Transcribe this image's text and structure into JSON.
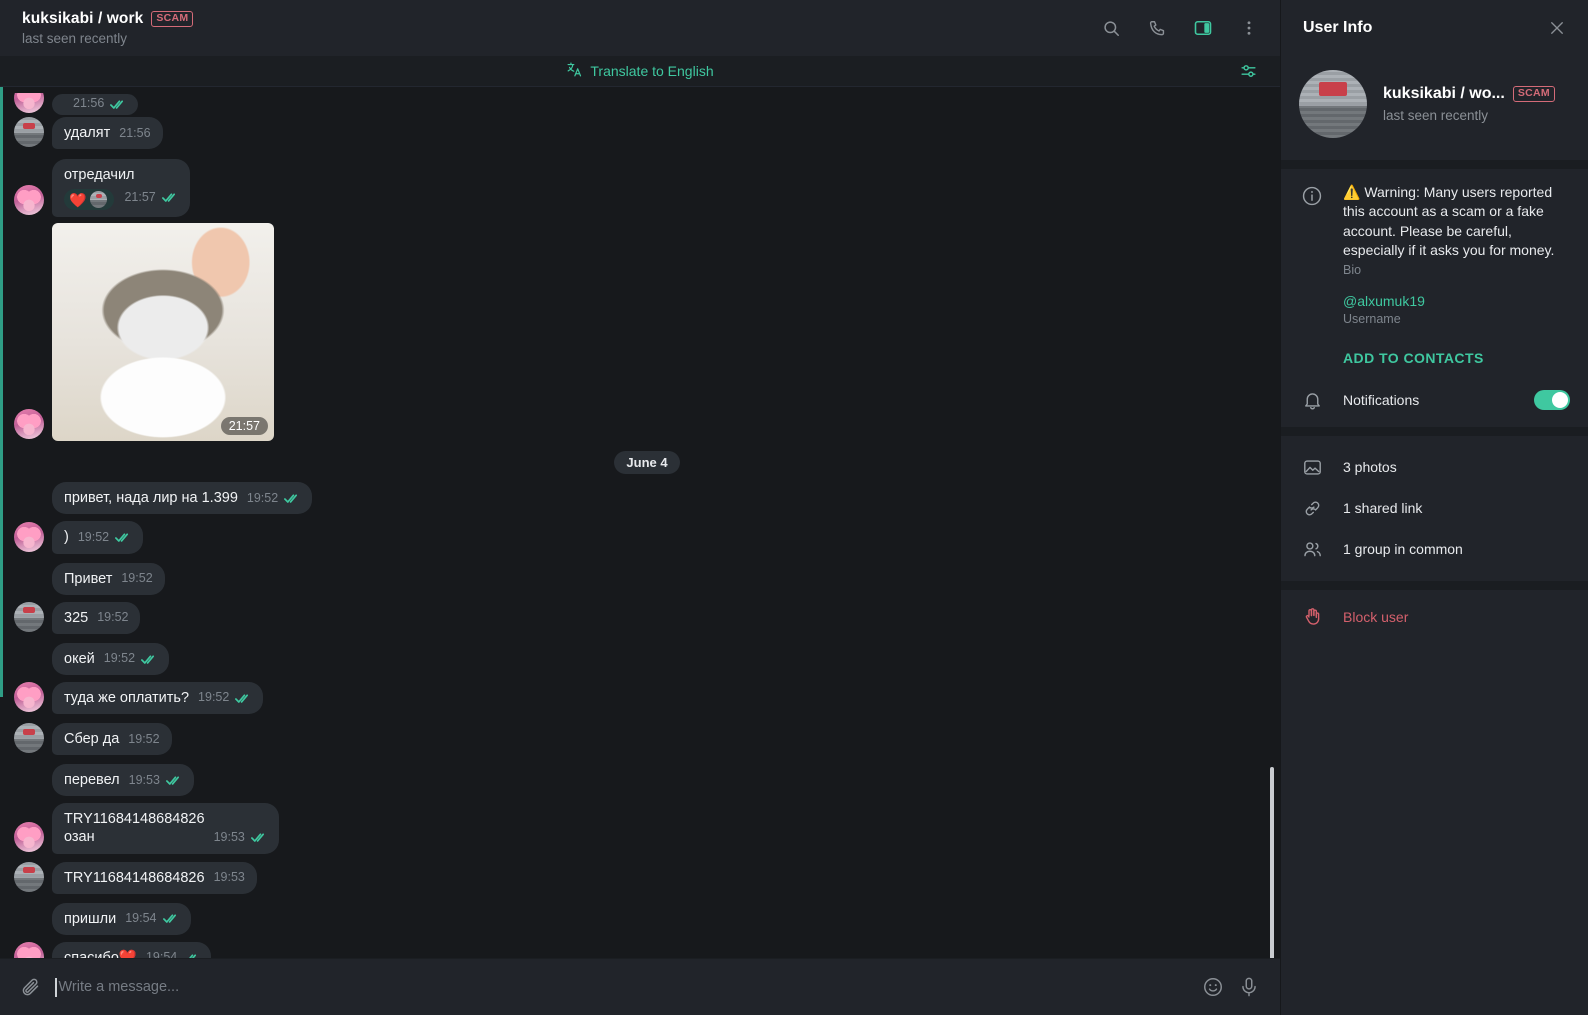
{
  "header": {
    "title": "kuksikabi / work",
    "badge": "SCAM",
    "subtitle": "last seen recently",
    "actions": [
      {
        "name": "search-icon",
        "label": "Search"
      },
      {
        "name": "phone-icon",
        "label": "Call"
      },
      {
        "name": "sidebar-toggle-icon",
        "label": "Toggle info panel",
        "active": true
      },
      {
        "name": "more-options-icon",
        "label": "More"
      }
    ]
  },
  "translate_bar": {
    "label": "Translate to English",
    "icon": "translate-icon",
    "settings_icon": "translate-settings-icon"
  },
  "messages": [
    {
      "id": "m0",
      "partial": true,
      "text": "",
      "time": "21:56",
      "outgoing": true,
      "avatar": "pink"
    },
    {
      "id": "m1",
      "text": "удалят",
      "time": "21:56",
      "outgoing": false,
      "avatar": "dark",
      "tail": true
    },
    {
      "id": "m2",
      "text": "отредачил",
      "time": "21:57",
      "outgoing": true,
      "avatar": "pink",
      "tail": true,
      "reaction": {
        "emoji": "❤️",
        "avatar": "dark"
      }
    },
    {
      "id": "m3",
      "type": "photo",
      "time": "21:57",
      "avatar": "pink",
      "alt": "cat being petted"
    },
    {
      "id": "d1",
      "type": "date",
      "label": "June 4"
    },
    {
      "id": "m4",
      "text": "привет, нада лир на 1.399",
      "time": "19:52",
      "outgoing": true,
      "avatar": "none"
    },
    {
      "id": "m5",
      "text": ")",
      "time": "19:52",
      "outgoing": true,
      "avatar": "pink",
      "tail": true
    },
    {
      "id": "m6",
      "text": "Привет",
      "time": "19:52",
      "outgoing": false,
      "avatar": "none"
    },
    {
      "id": "m7",
      "text": "325",
      "time": "19:52",
      "outgoing": false,
      "avatar": "dark",
      "tail": true
    },
    {
      "id": "m8",
      "text": "окей",
      "time": "19:52",
      "outgoing": true,
      "avatar": "none"
    },
    {
      "id": "m9",
      "text": "туда же оплатить?",
      "time": "19:52",
      "outgoing": true,
      "avatar": "pink",
      "tail": true
    },
    {
      "id": "m10",
      "text": "Сбер да",
      "time": "19:52",
      "outgoing": false,
      "avatar": "dark",
      "tail": true
    },
    {
      "id": "m11",
      "text": "перевел",
      "time": "19:53",
      "outgoing": true,
      "avatar": "none"
    },
    {
      "id": "m12",
      "text": "TRY11684148684826\nозан",
      "time": "19:53",
      "outgoing": true,
      "avatar": "pink",
      "tail": true
    },
    {
      "id": "m13",
      "text": "TRY11684148684826",
      "time": "19:53",
      "outgoing": false,
      "avatar": "dark",
      "tail": true
    },
    {
      "id": "m14",
      "text": "пришли",
      "time": "19:54",
      "outgoing": true,
      "avatar": "none"
    },
    {
      "id": "m15",
      "text": "спасибо❤️",
      "time": "19:54",
      "outgoing": true,
      "avatar": "pink",
      "tail": true
    }
  ],
  "composer": {
    "attach_icon": "paperclip-icon",
    "placeholder": "Write a message...",
    "value": "",
    "emoji_icon": "emoji-icon",
    "mic_icon": "microphone-icon"
  },
  "info_panel": {
    "title": "User Info",
    "close_icon": "close-icon",
    "profile": {
      "name": "kuksikabi / wo...",
      "badge": "SCAM",
      "subtitle": "last seen recently"
    },
    "bio": {
      "warning_emoji": "⚠️",
      "text": "Warning: Many users reported this account as a scam or a fake account. Please be careful, especially if it asks you for money.",
      "label": "Bio"
    },
    "username": {
      "value": "@alxumuk19",
      "label": "Username"
    },
    "add_to_contacts": "ADD TO CONTACTS",
    "notifications": {
      "label": "Notifications",
      "enabled": true
    },
    "media": [
      {
        "icon": "photos-icon",
        "label": "3 photos"
      },
      {
        "icon": "link-icon",
        "label": "1 shared link"
      },
      {
        "icon": "group-icon",
        "label": "1 group in common"
      }
    ],
    "block": {
      "icon": "block-hand-icon",
      "label": "Block user"
    }
  },
  "colors": {
    "accent": "#3fc8a0",
    "danger": "#d4606c",
    "bubble": "#2b3036",
    "chat_bg": "#17191c",
    "panel_bg": "#21242a"
  }
}
